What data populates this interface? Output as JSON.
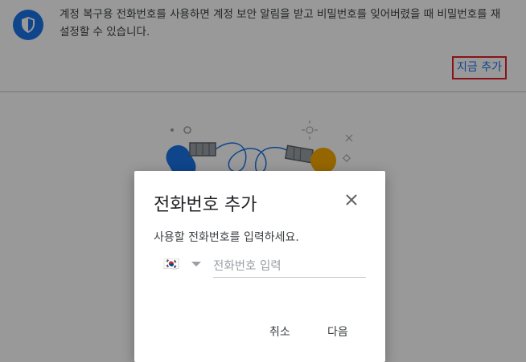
{
  "banner": {
    "icon": "shield-icon",
    "text": "계정 복구용 전화번호를 사용하면 계정 보안 알림을 받고 비밀번호를 잊어버렸을 때 비밀번호를 재설정할 수 있습니다.",
    "add_now_label": "지금 추가",
    "accent_color": "#1a73e8",
    "highlight_color": "#e0202a"
  },
  "illustration": {
    "icon": "phones-connected-illustration"
  },
  "dialog": {
    "title": "전화번호 추가",
    "description": "사용할 전화번호를 입력하세요.",
    "country_flag": "🇰🇷",
    "phone_placeholder": "전화번호 입력",
    "phone_value": "",
    "cancel_label": "취소",
    "next_label": "다음"
  }
}
